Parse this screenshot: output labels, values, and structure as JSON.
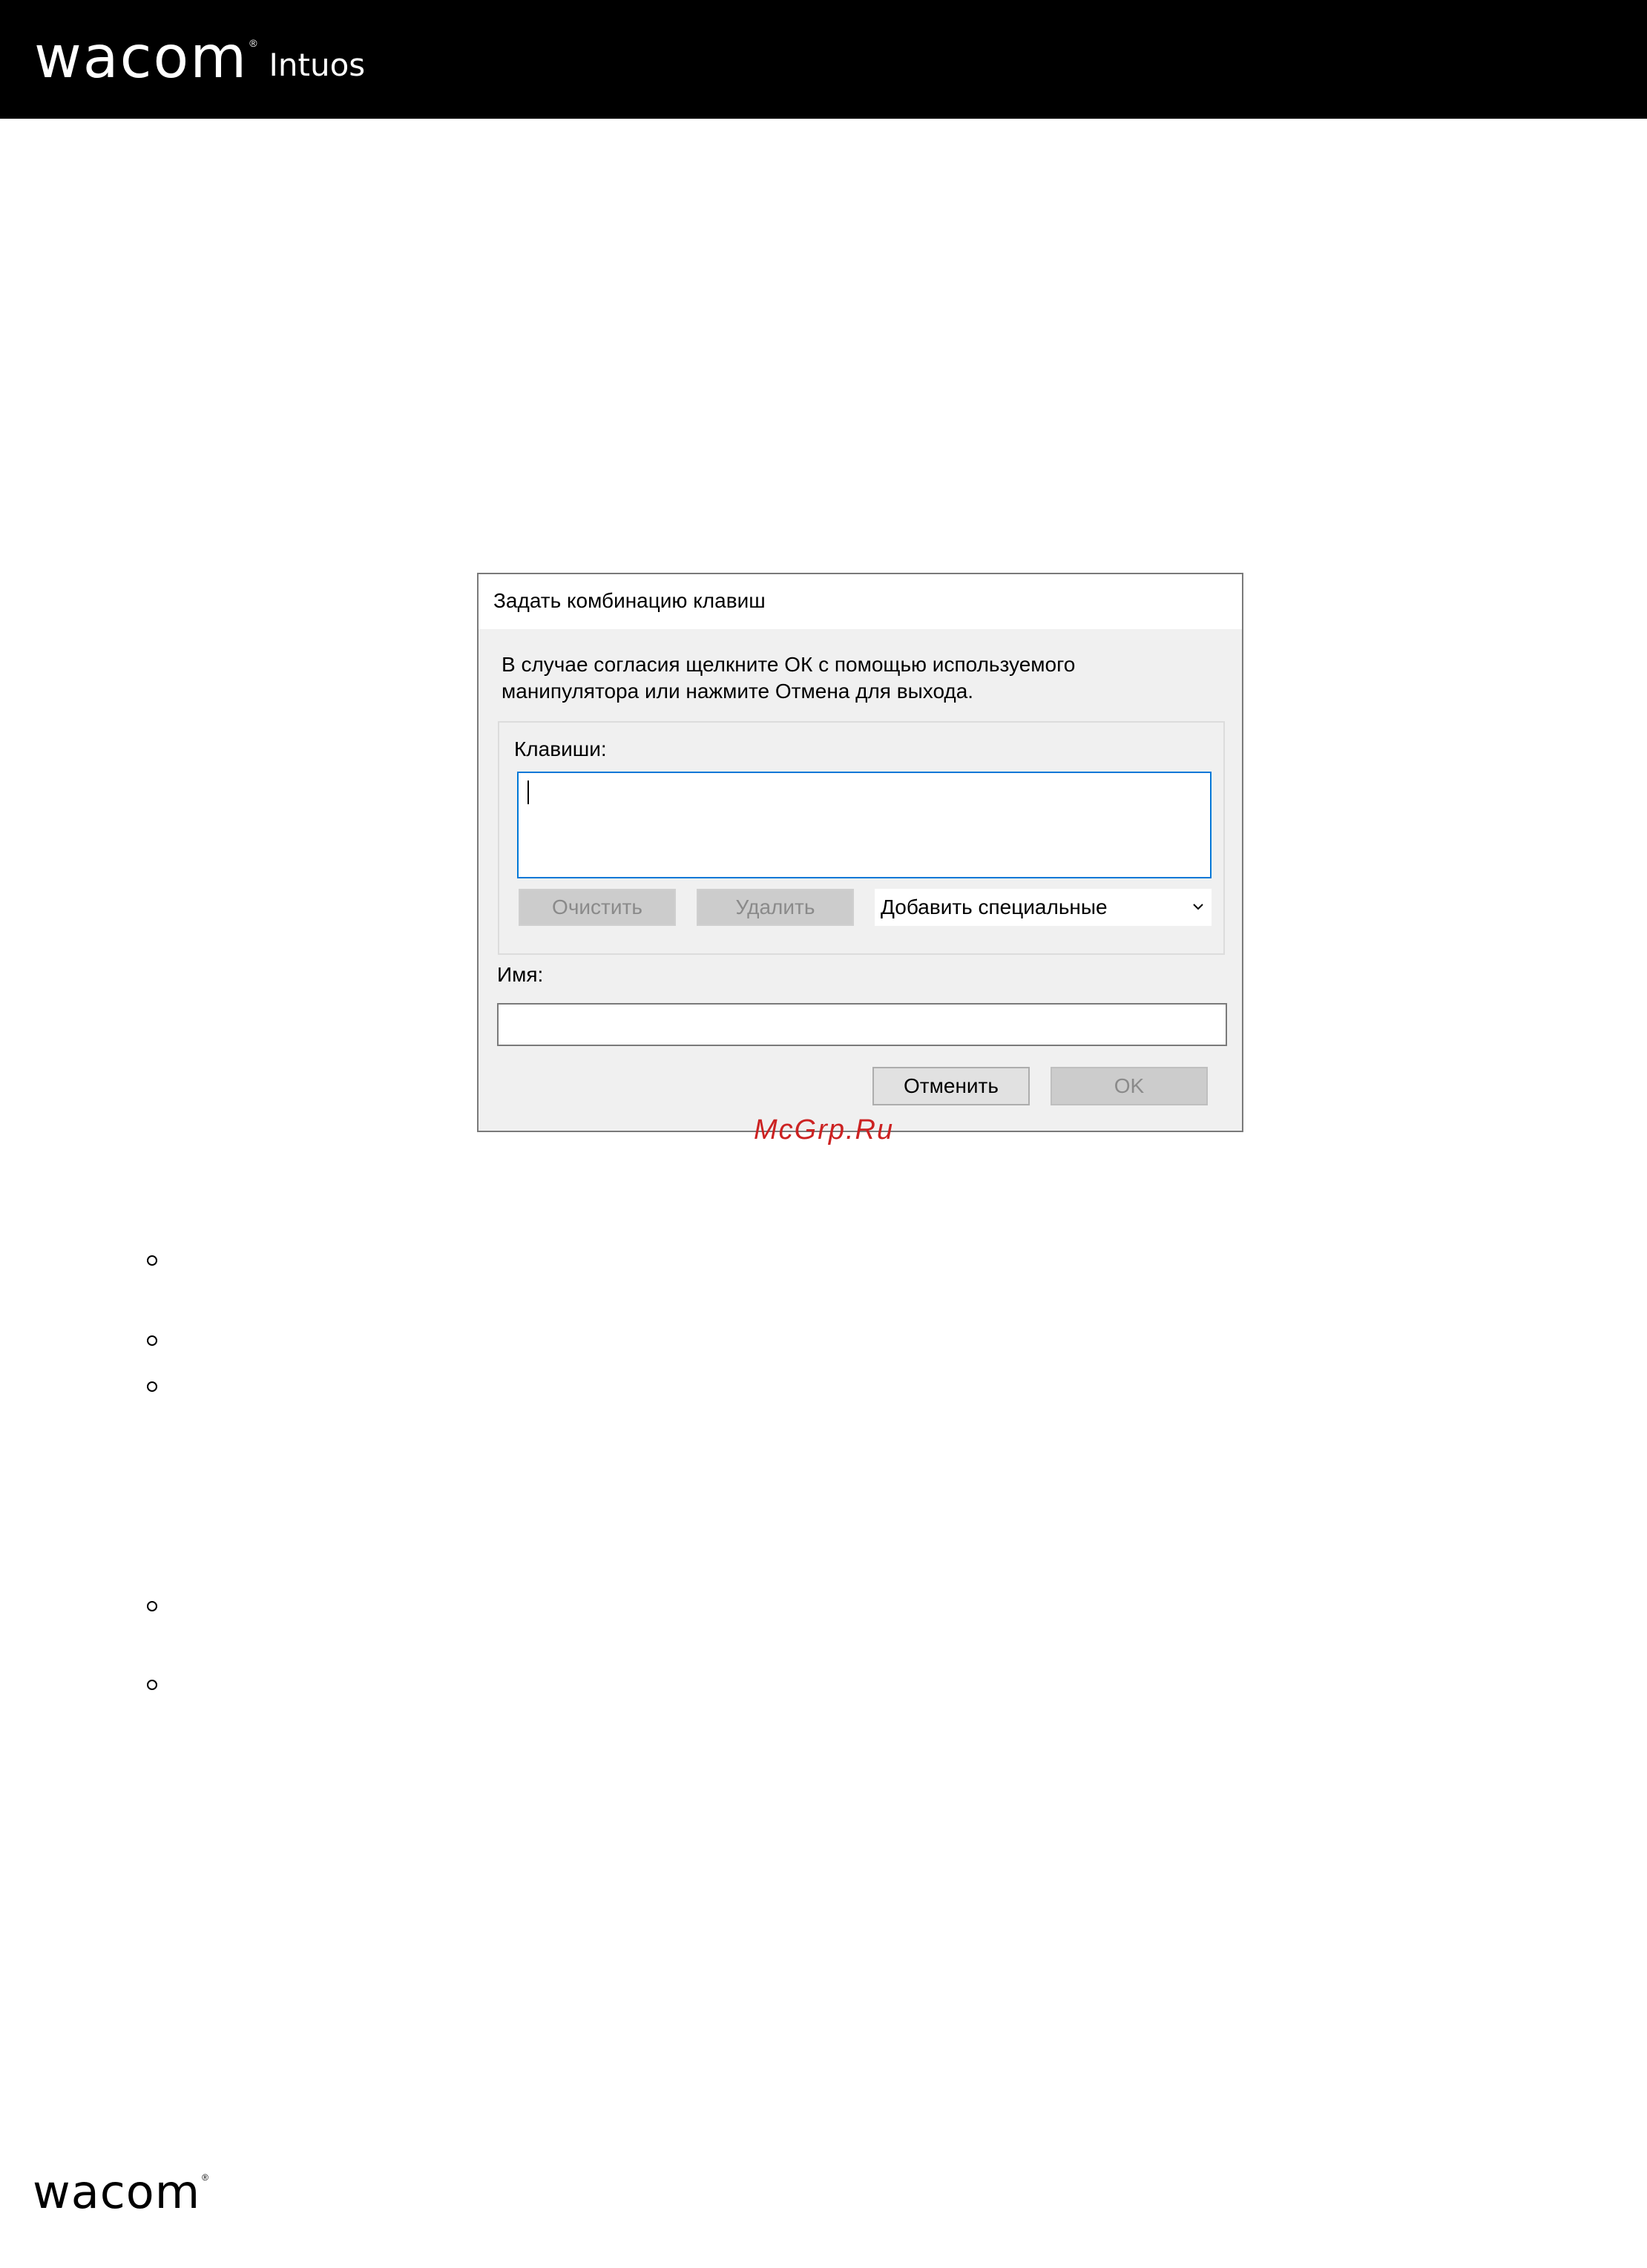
{
  "header": {
    "brand": "wacom",
    "registered_mark": "®",
    "product": "Intuos"
  },
  "dialog": {
    "title": "Задать комбинацию клавиш",
    "message": "В случае согласия щелкните ОК с помощью используемого манипулятора или нажмите Отмена для выхода.",
    "keys_label": "Клавиши:",
    "keys_value": "",
    "clear_button": "Очистить",
    "delete_button": "Удалить",
    "special_select": "Добавить специальные",
    "name_label": "Имя:",
    "name_value": "",
    "cancel_button": "Отменить",
    "ok_button": "OK"
  },
  "watermark": "McGrp.Ru",
  "footer": {
    "brand": "wacom",
    "registered_mark": "®"
  }
}
